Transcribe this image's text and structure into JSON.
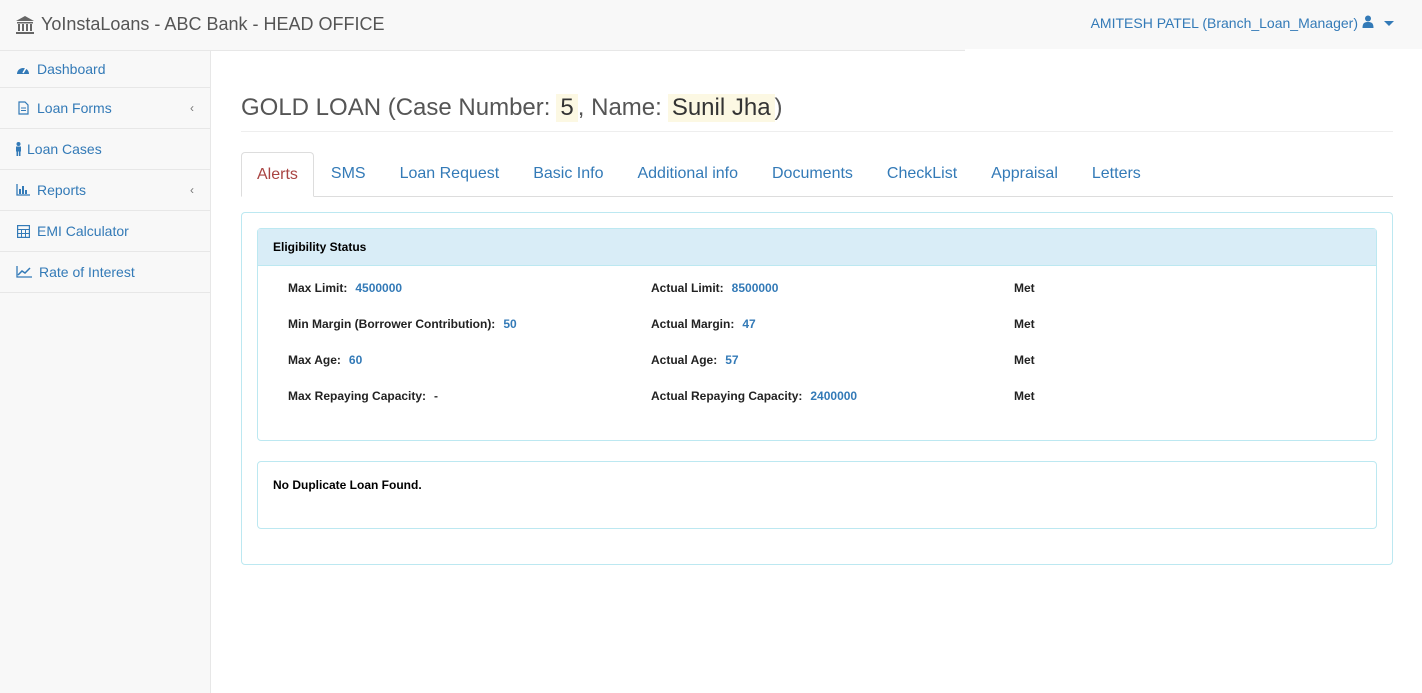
{
  "header": {
    "brand": "YoInstaLoans - ABC Bank - HEAD OFFICE",
    "user": "AMITESH PATEL (Branch_Loan_Manager)"
  },
  "sidebar": {
    "items": [
      {
        "label": "Dashboard",
        "icon": "dashboard-icon"
      },
      {
        "label": "Loan Forms",
        "icon": "file-icon"
      },
      {
        "label": "Loan Cases",
        "icon": "person-icon"
      },
      {
        "label": "Reports",
        "icon": "bar-chart-icon"
      },
      {
        "label": "EMI Calculator",
        "icon": "calculator-icon"
      },
      {
        "label": "Rate of Interest",
        "icon": "line-chart-icon"
      }
    ]
  },
  "page": {
    "title_prefix": "GOLD LOAN (Case Number:",
    "case_number": "5",
    "name_sep": ", Name:",
    "name": "Sunil Jha",
    "title_suffix": ")"
  },
  "tabs": [
    "Alerts",
    "SMS",
    "Loan Request",
    "Basic Info",
    "Additional info",
    "Documents",
    "CheckList",
    "Appraisal",
    "Letters"
  ],
  "eligibility": {
    "heading": "Eligibility Status",
    "rows": [
      {
        "limit_label": "Max Limit:",
        "limit_value": "4500000",
        "actual_label": "Actual Limit:",
        "actual_value": "8500000",
        "status": "Met"
      },
      {
        "limit_label": "Min Margin (Borrower Contribution):",
        "limit_value": "50",
        "actual_label": "Actual Margin:",
        "actual_value": "47",
        "status": "Met"
      },
      {
        "limit_label": "Max Age:",
        "limit_value": "60",
        "actual_label": "Actual Age:",
        "actual_value": "57",
        "status": "Met"
      },
      {
        "limit_label": "Max Repaying Capacity:",
        "limit_value": "-",
        "actual_label": "Actual Repaying Capacity:",
        "actual_value": "2400000",
        "status": "Met"
      }
    ]
  },
  "duplicate": {
    "message": "No Duplicate Loan Found."
  },
  "colors": {
    "link": "#337ab7",
    "active_tab": "#a94442",
    "highlight": "#fcf8e3",
    "panel_heading": "#d9edf7",
    "panel_border": "#bce8f1"
  }
}
